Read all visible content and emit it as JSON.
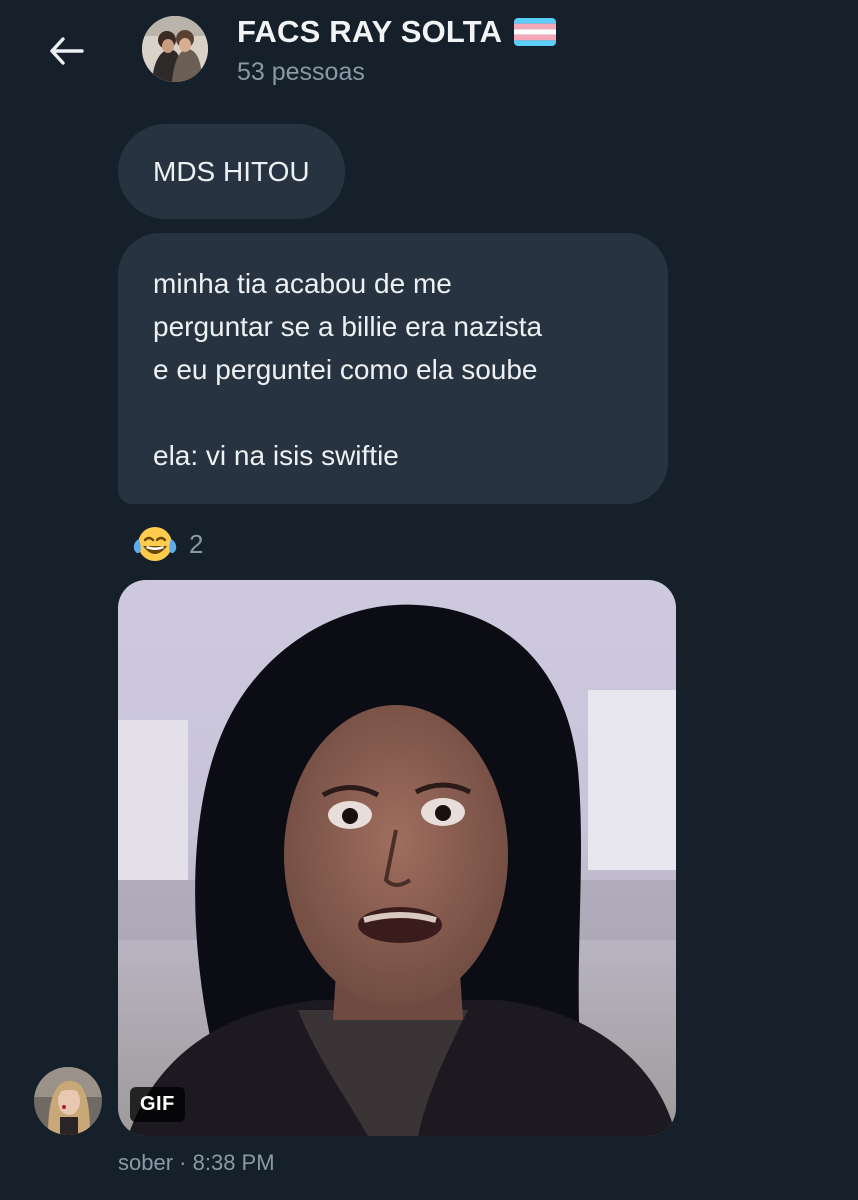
{
  "header": {
    "back_icon": "arrow-left-icon",
    "title": "FACS RAY SOLTA",
    "title_flag_icon": "transgender-flag-icon",
    "subtitle": "53 pessoas"
  },
  "messages": [
    {
      "text": "MDS HITOU"
    },
    {
      "lines": [
        "minha tia acabou de me",
        "perguntar se a billie era nazista",
        "e eu perguntei como ela soube",
        "",
        "ela: vi na isis swiftie"
      ]
    }
  ],
  "reaction": {
    "emoji_icon": "face-with-tears-of-joy-icon",
    "emoji": "😂",
    "count": "2"
  },
  "gif": {
    "badge": "GIF"
  },
  "meta": {
    "sender": "sober",
    "separator": "·",
    "time": "8:38 PM"
  },
  "colors": {
    "background": "#15202b",
    "bubble": "#273340",
    "muted_text": "#8b98a5",
    "text": "#e7e9ea"
  }
}
